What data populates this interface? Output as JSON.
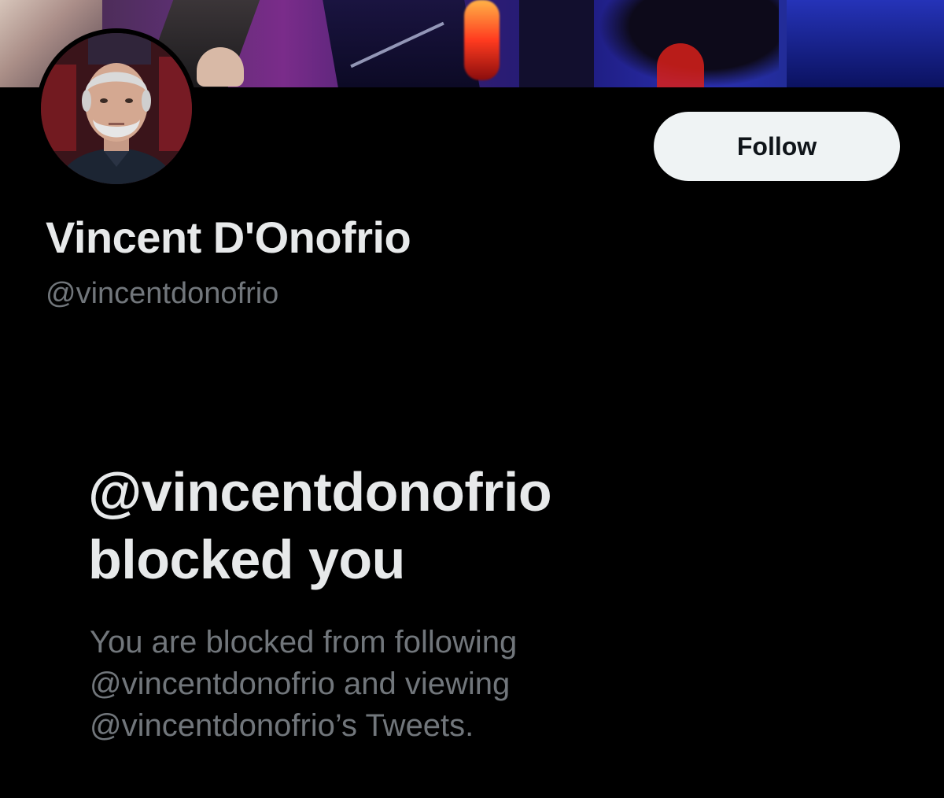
{
  "profile": {
    "display_name": "Vincent D'Onofrio",
    "handle": "@vincentdonofrio",
    "follow_label": "Follow"
  },
  "blocked_notice": {
    "title_line1": "@vincentdonofrio",
    "title_line2": "blocked you",
    "desc_line1": "You are blocked from following",
    "desc_line2": "@vincentdonofrio and viewing",
    "desc_line3": "@vincentdonofrio’s Tweets."
  },
  "colors": {
    "background": "#000000",
    "primary_text": "#e7e9ea",
    "secondary_text": "#71767b",
    "follow_button_bg": "#eff3f4",
    "follow_button_text": "#0f1419"
  }
}
